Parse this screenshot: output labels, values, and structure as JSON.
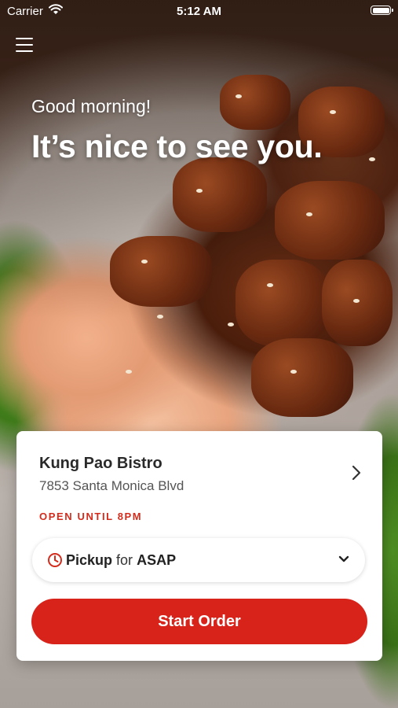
{
  "status_bar": {
    "carrier": "Carrier",
    "time": "5:12 AM"
  },
  "hero": {
    "greeting": "Good morning!",
    "headline": "It’s nice to see you."
  },
  "store": {
    "name": "Kung Pao Bistro",
    "address": "7853 Santa Monica Blvd",
    "hours": "OPEN UNTIL 8PM"
  },
  "order_mode": {
    "mode": "Pickup",
    "for_label": "for",
    "time": "ASAP"
  },
  "actions": {
    "start_order": "Start Order"
  },
  "colors": {
    "accent": "#d8231a",
    "hours_text": "#d42c1c"
  },
  "icons": {
    "menu": "hamburger-menu-icon",
    "wifi": "wifi-icon",
    "battery": "battery-icon",
    "chevron": "chevron-right-icon",
    "clock": "clock-icon",
    "dropdown": "chevron-down-icon"
  }
}
